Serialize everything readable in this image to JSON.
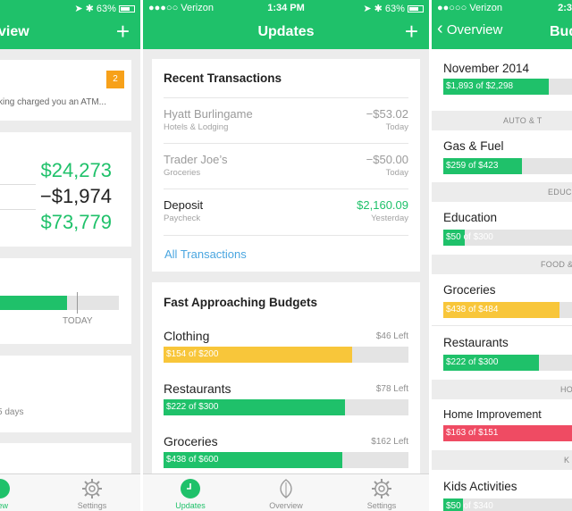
{
  "left": {
    "status": {
      "battery": "63%"
    },
    "nav_title": "view",
    "notification": {
      "badge": "2",
      "text": "king charged you an ATM..."
    },
    "summary": [
      "$24,273",
      "−$1,974",
      "$73,779"
    ],
    "today_label": "TODAY",
    "days_text": "5 days",
    "tabs": {
      "overview": "view",
      "settings": "Settings"
    }
  },
  "middle": {
    "status": {
      "carrier": "●●●○○ Verizon",
      "time": "1:34 PM",
      "battery": "63%"
    },
    "nav_title": "Updates",
    "recent": {
      "title": "Recent Transactions",
      "items": [
        {
          "name": "Hyatt Burlingame",
          "category": "Hotels & Lodging",
          "amount": "−$53.02",
          "when": "Today"
        },
        {
          "name": "Trader Joe’s",
          "category": "Groceries",
          "amount": "−$50.00",
          "when": "Today"
        },
        {
          "name": "Deposit",
          "category": "Paycheck",
          "amount": "$2,160.09",
          "when": "Yesterday"
        }
      ],
      "link": "All Transactions"
    },
    "budgets": {
      "title": "Fast Approaching Budgets",
      "items": [
        {
          "name": "Clothing",
          "left": "$46 Left",
          "label": "$154 of $200",
          "progress": 0.77,
          "color": "#f8c63a"
        },
        {
          "name": "Restaurants",
          "left": "$78 Left",
          "label": "$222 of $300",
          "progress": 0.74,
          "color": "#1fc16a"
        },
        {
          "name": "Groceries",
          "left": "$162 Left",
          "label": "$438 of $600",
          "progress": 0.73,
          "color": "#1fc16a"
        }
      ]
    },
    "tabs": {
      "updates": "Updates",
      "overview": "Overview",
      "settings": "Settings"
    }
  },
  "right": {
    "status": {
      "carrier": "●●○○○ Verizon",
      "time": "2:3"
    },
    "back_label": "Overview",
    "nav_title": "Bud",
    "month": {
      "name": "November 2014",
      "label": "$1,893 of $2,298",
      "progress": 0.82
    },
    "sections": [
      {
        "header": "AUTO & T",
        "rows": [
          {
            "name": "Gas & Fuel",
            "label": "$259 of $423",
            "progress": 0.61,
            "color": "#1fc16a"
          }
        ]
      },
      {
        "header": "EDUC",
        "rows": [
          {
            "name": "Education",
            "label": "$50 of $300",
            "progress": 0.17,
            "color": "#1fc16a"
          }
        ]
      },
      {
        "header": "FOOD &",
        "rows": [
          {
            "name": "Groceries",
            "label": "$438 of $484",
            "progress": 0.9,
            "color": "#f8c63a"
          },
          {
            "name": "Restaurants",
            "label": "$222 of $300",
            "progress": 0.74,
            "color": "#1fc16a"
          }
        ]
      },
      {
        "header": "HO",
        "rows": [
          {
            "name": "Home Improvement",
            "label": "$163 of $151",
            "progress": 1.0,
            "color": "#ef4b63"
          }
        ]
      },
      {
        "header": "K",
        "rows": [
          {
            "name": "Kids Activities",
            "label": "$50 of $340",
            "progress": 0.15,
            "color": "#1fc16a"
          }
        ]
      }
    ]
  }
}
